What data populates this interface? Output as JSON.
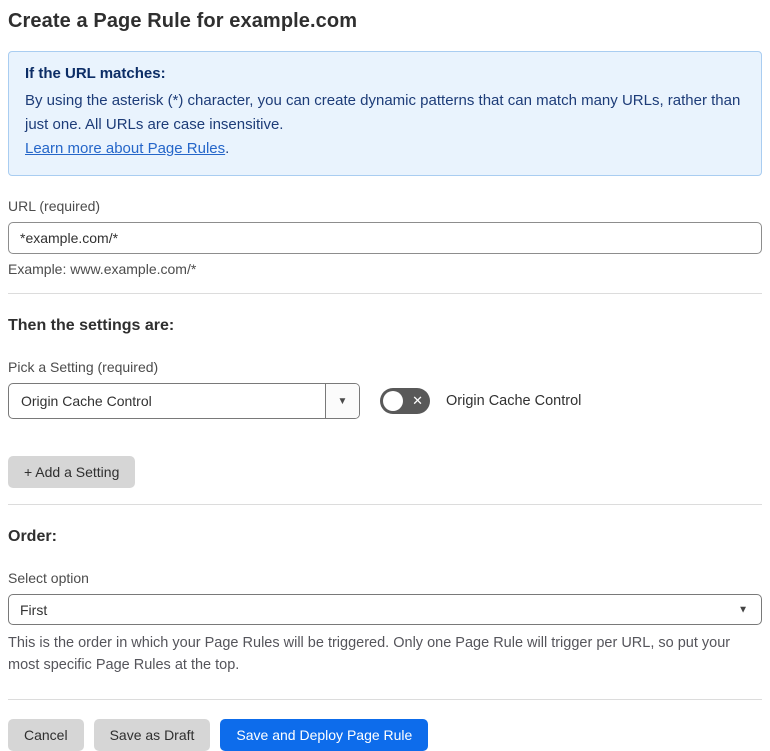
{
  "page": {
    "title": "Create a Page Rule for example.com"
  },
  "info_box": {
    "heading": "If the URL matches:",
    "body": "By using the asterisk (*) character, you can create dynamic patterns that can match many URLs, rather than just one. All URLs are case insensitive.",
    "link_label": "Learn more about Page Rules",
    "link_suffix": "."
  },
  "url_section": {
    "label": "URL (required)",
    "value": "*example.com/*",
    "helper": "Example: www.example.com/*"
  },
  "settings_section": {
    "heading": "Then the settings are:",
    "picker_label": "Pick a Setting (required)",
    "picker_value": "Origin Cache Control",
    "picker_arrow_icon": "▼",
    "toggle_state": "off",
    "toggle_off_icon": "✕",
    "toggle_label": "Origin Cache Control",
    "add_button_label": "+ Add a Setting"
  },
  "order_section": {
    "heading": "Order:",
    "select_label": "Select option",
    "select_value": "First",
    "select_caret_icon": "▼",
    "helper": "This is the order in which your Page Rules will be triggered. Only one Page Rule will trigger per URL, so put your most specific Page Rules at the top."
  },
  "footer": {
    "cancel_label": "Cancel",
    "save_draft_label": "Save as Draft",
    "save_deploy_label": "Save and Deploy Page Rule"
  },
  "colors": {
    "accent_blue": "#0d6ceb",
    "info_bg": "#e9f3fd",
    "info_border": "#a9cdf1",
    "info_heading_text": "#0c2d66",
    "info_body_text": "#1d3c78",
    "link_blue": "#2566c9",
    "toggle_off_bg": "#595959",
    "button_gray": "#d6d6d6"
  }
}
